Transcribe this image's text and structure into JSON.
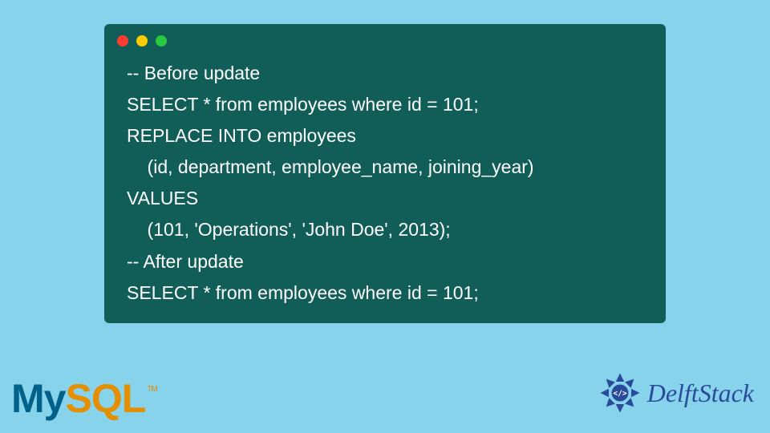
{
  "code": {
    "lines": [
      "-- Before update",
      "SELECT * from employees where id = 101;",
      "REPLACE INTO employees",
      "    (id, department, employee_name, joining_year)",
      "VALUES",
      "    (101, 'Operations', 'John Doe', 2013);",
      "-- After update",
      "SELECT * from employees where id = 101;"
    ]
  },
  "logos": {
    "mysql_my": "My",
    "mysql_sql": "SQL",
    "mysql_tm": "TM",
    "delft": "DelftStack"
  },
  "colors": {
    "bg": "#87d3ec",
    "window": "#115e59",
    "mysql_blue": "#00618a",
    "mysql_orange": "#e48e00",
    "delft_blue": "#2a4b9b"
  }
}
